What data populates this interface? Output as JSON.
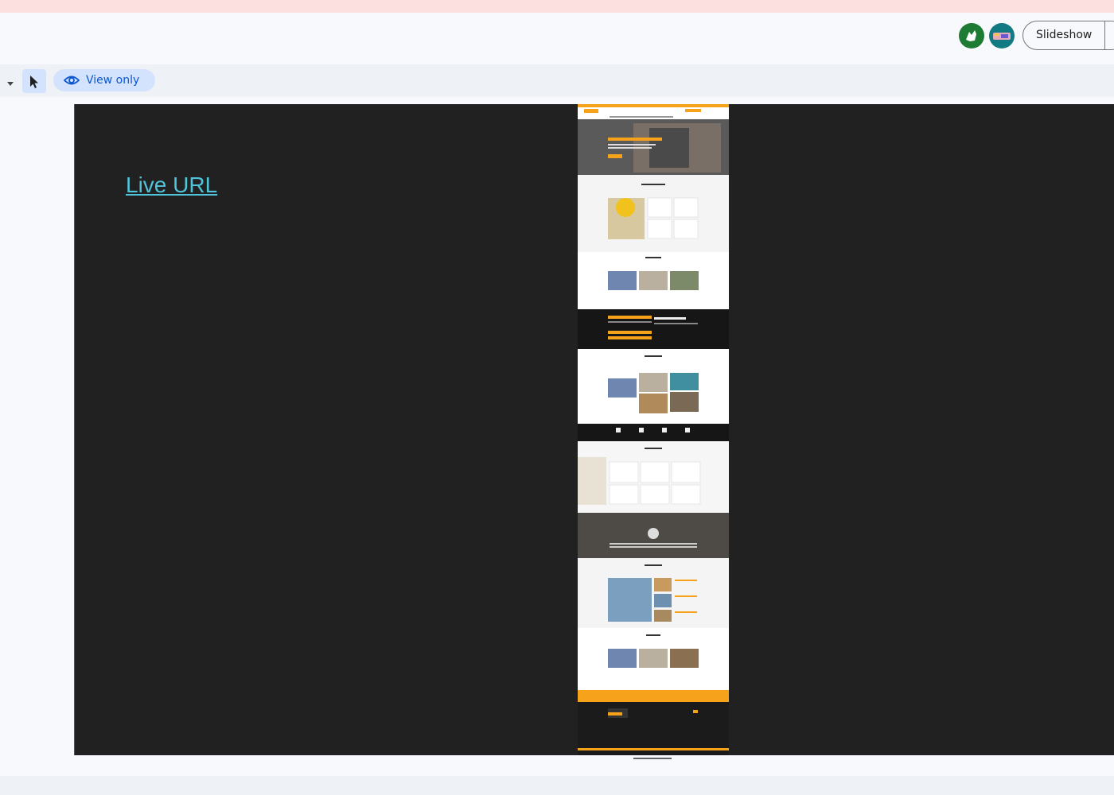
{
  "header": {
    "slideshow_label": "Slideshow",
    "avatars": [
      {
        "icon": "green-avatar-icon",
        "color": "#1e7b34"
      },
      {
        "icon": "teal-avatar-icon",
        "color": "#127a82"
      }
    ]
  },
  "toolbar": {
    "mode_label": "View only",
    "mode_icon": "eye-icon",
    "select_icon": "cursor-arrow-icon",
    "dropdown_icon": "caret-down-icon"
  },
  "slide": {
    "link_text": "Live URL",
    "background": "#212121",
    "link_color": "#4fc3d9",
    "thumbnail": {
      "hero_text": "WE BUILD YOUR DREAM",
      "accent": "#f7a21b",
      "dark": "#1b1b1b"
    }
  }
}
